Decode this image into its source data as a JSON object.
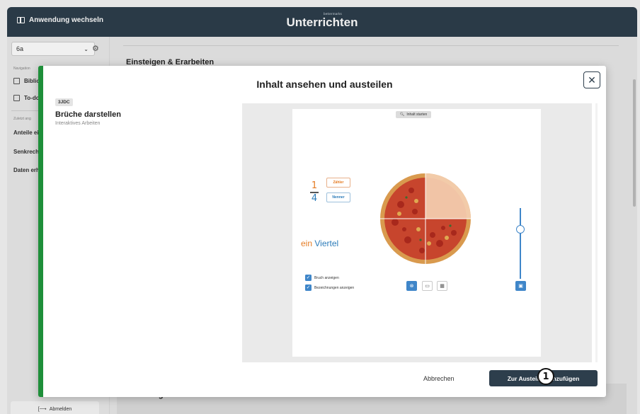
{
  "header": {
    "switch_app_label": "Anwendung wechseln",
    "brand_small": "bettermarks",
    "title": "Unterrichten"
  },
  "sidebar": {
    "class_value": "6a",
    "nav_label": "Navigation",
    "items": [
      {
        "label": "Biblio"
      },
      {
        "label": "To-do"
      }
    ],
    "recent_label": "Zuletzt ang",
    "recent_items": [
      {
        "label": "Anteile ei"
      },
      {
        "label": "Senkrecht"
      },
      {
        "label": "Daten erh"
      }
    ],
    "logout_label": "Abmelden"
  },
  "background": {
    "section_heading": "Einsteigen & Erarbeiten",
    "section_heading_2": "Basisaufgaben"
  },
  "modal": {
    "title": "Inhalt ansehen und austeilen",
    "badge": "3JDC",
    "content_title": "Brüche darstellen",
    "content_subtitle": "Interaktives Arbeiten",
    "cancel_label": "Abbrechen",
    "primary_label": "Zur Austeil-Liste hinzufügen",
    "primary_label_visible": "Zur Austeil-L    inzufügen"
  },
  "preview": {
    "start_label": "Inhalt starten",
    "numerator": "1",
    "denominator": "4",
    "numerator_label": "Zähler",
    "denominator_label": "Nenner",
    "word_1": "ein",
    "word_2": "Viertel",
    "checkbox_1": "Bruch anzeigen",
    "checkbox_2": "Bezeichnungen anzeigen",
    "slider_level": 0.7,
    "colors": {
      "orange": "#e57c24",
      "blue": "#2b7bb9",
      "green": "#1f8f3a",
      "navy": "#2d3e4c"
    }
  },
  "marker": {
    "label": "1"
  }
}
